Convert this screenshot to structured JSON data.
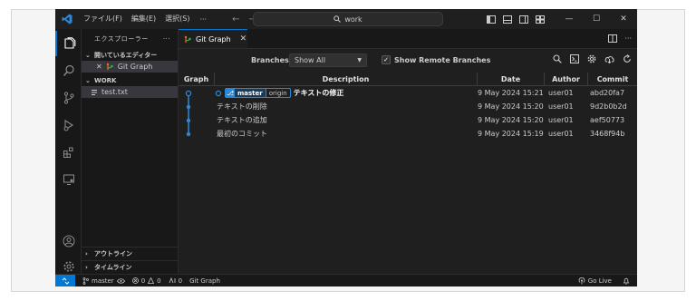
{
  "titlebar": {
    "menus": [
      "ファイル(F)",
      "編集(E)",
      "選択(S)"
    ],
    "more": "···",
    "back_arrow": "←",
    "forward_arrow": "→",
    "search_text": "work",
    "minimize": "—",
    "maximize": "☐",
    "close": "✕"
  },
  "sidebar": {
    "title": "エクスプローラー",
    "more": "···",
    "open_editors": {
      "label": "開いているエディター",
      "items": [
        {
          "close": "✕",
          "name": "Git Graph"
        }
      ]
    },
    "workspace": {
      "label": "WORK",
      "files": [
        {
          "name": "test.txt"
        }
      ]
    },
    "outline_label": "アウトライン",
    "timeline_label": "タイムライン"
  },
  "editor": {
    "tab": {
      "label": "Git Graph",
      "close": "✕"
    },
    "controls": {
      "branches_label": "Branches:",
      "branches_value": "Show All",
      "show_remote_label": "Show Remote Branches",
      "show_remote_checked": true
    },
    "table": {
      "headers": [
        "Graph",
        "Description",
        "Date",
        "Author",
        "Commit"
      ],
      "rows": [
        {
          "branch": "master",
          "origin": "origin",
          "description": "テキストの修正",
          "date": "9 May 2024 15:21",
          "author": "user01",
          "commit": "abd20fa7"
        },
        {
          "description": "テキストの削除",
          "date": "9 May 2024 15:20",
          "author": "user01",
          "commit": "9d2b0b2d"
        },
        {
          "description": "テキストの追加",
          "date": "9 May 2024 15:20",
          "author": "user01",
          "commit": "aef50773"
        },
        {
          "description": "最初のコミット",
          "date": "9 May 2024 15:19",
          "author": "user01",
          "commit": "3468f94b"
        }
      ]
    }
  },
  "statusbar": {
    "branch": "master",
    "errors": "0",
    "warnings": "0",
    "ports": "0",
    "git_graph": "Git Graph",
    "go_live": "Go Live"
  },
  "colors": {
    "accent": "#0078d4",
    "graph_line": "#2b88d8"
  }
}
